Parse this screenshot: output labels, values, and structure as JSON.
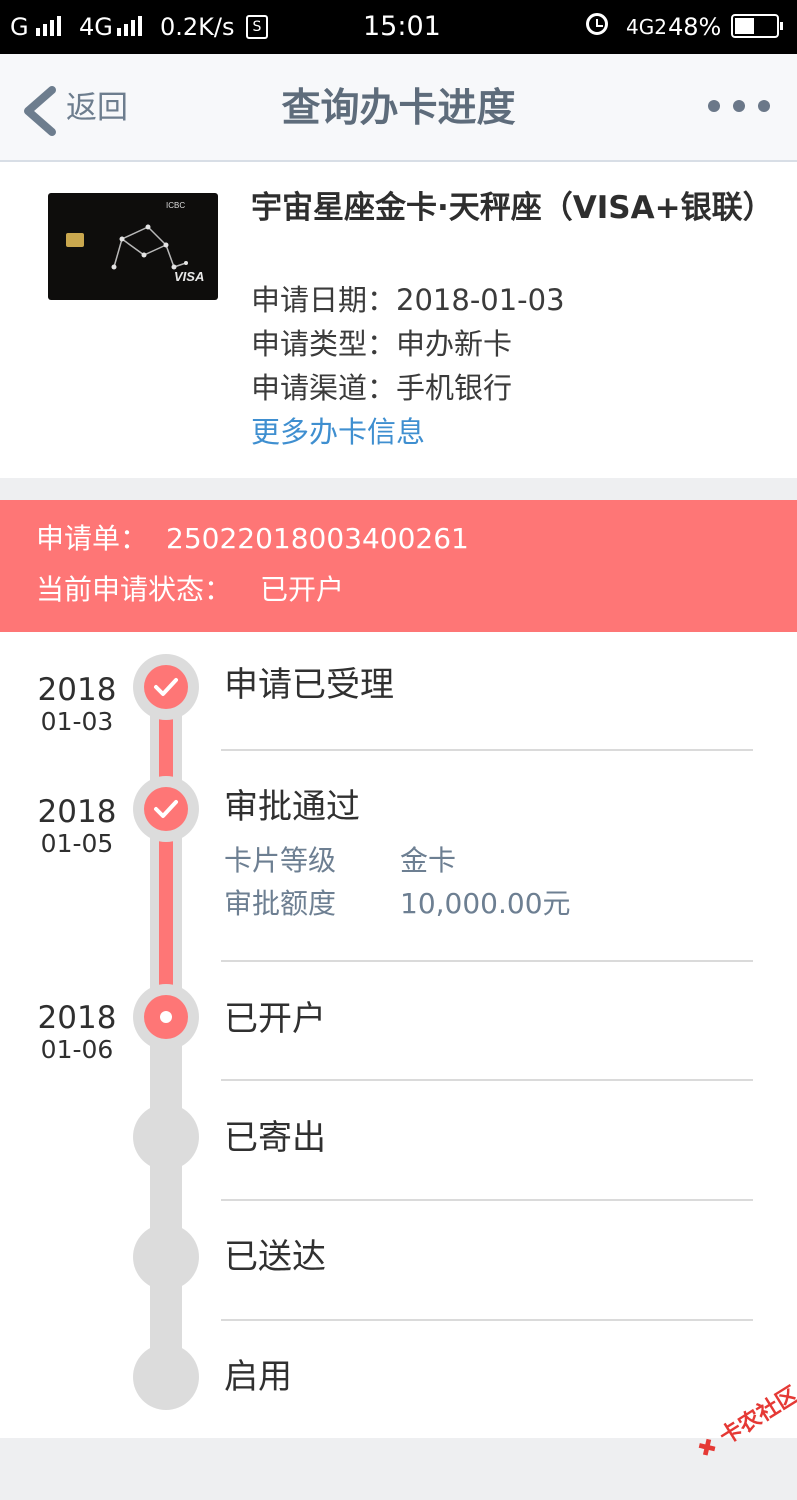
{
  "status_bar": {
    "carrier": "G",
    "network": "4G",
    "speed": "0.2K/s",
    "sim_icon_text": "S",
    "time": "15:01",
    "network2": "4G2",
    "battery": "48%",
    "battery_level": 0.48
  },
  "nav": {
    "back_label": "返回",
    "title": "查询办卡进度",
    "more_icon": "ellipsis-icon"
  },
  "card": {
    "name": "宇宙星座金卡·天秤座（VISA+银联）",
    "date_label": "申请日期：",
    "date_value": "2018-01-03",
    "type_label": "申请类型：",
    "type_value": "申办新卡",
    "channel_label": "申请渠道：",
    "channel_value": "手机银行",
    "more_link": "更多办卡信息",
    "image_bank_text": "ICBC",
    "image_network_text": "VISA"
  },
  "banner": {
    "order_label": "申请单：",
    "order_number": "25022018003400261",
    "status_label": "当前申请状态：",
    "status_value": "已开户",
    "color": "#fe7676"
  },
  "timeline": {
    "steps": [
      {
        "year": "2018",
        "date": "01-03",
        "title": "申请已受理",
        "state": "done"
      },
      {
        "year": "2018",
        "date": "01-05",
        "title": "审批通过",
        "state": "done",
        "details": [
          {
            "label": "卡片等级",
            "value": "金卡"
          },
          {
            "label": "审批额度",
            "value": "10,000.00元"
          }
        ]
      },
      {
        "year": "2018",
        "date": "01-06",
        "title": "已开户",
        "state": "current"
      },
      {
        "year": "",
        "date": "",
        "title": "已寄出",
        "state": "pending"
      },
      {
        "year": "",
        "date": "",
        "title": "已送达",
        "state": "pending"
      },
      {
        "year": "",
        "date": "",
        "title": "启用",
        "state": "pending"
      }
    ]
  },
  "watermark": "卡农社区"
}
